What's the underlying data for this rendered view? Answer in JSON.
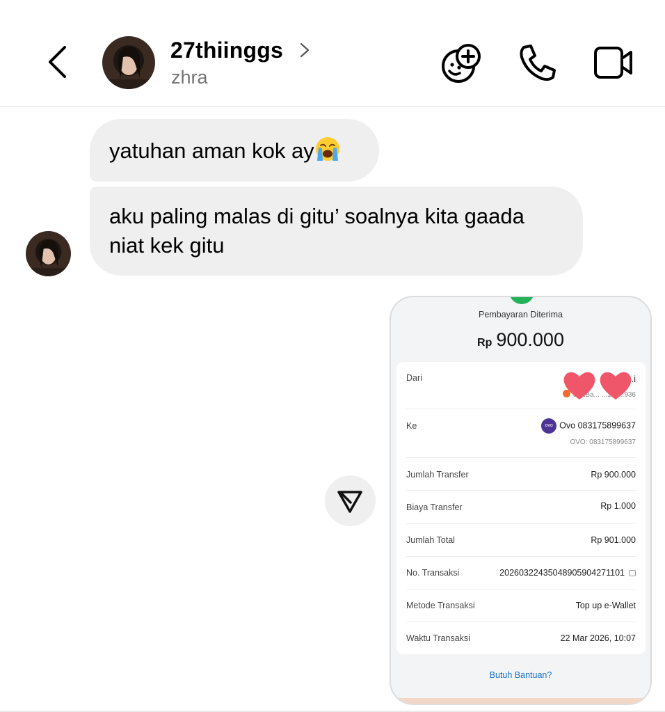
{
  "header": {
    "username": "27thiinggs",
    "subname": "zhra",
    "icons": [
      "back-chevron-icon",
      "add-friend-icon",
      "phone-icon",
      "video-camera-icon"
    ]
  },
  "messages": [
    {
      "text": "yatuhan aman kok ay",
      "emoji": "loudly-crying-face"
    },
    {
      "text": "aku paling malas di gitu’ soalnya kita gaada niat kek gitu"
    }
  ],
  "receipt": {
    "title": "Pembayaran Diterima",
    "currency": "Rp",
    "amount": "900.000",
    "rows": [
      {
        "label": "Dari",
        "value": "...i",
        "sub": "SeaBa... ...112...936"
      },
      {
        "label": "Ke",
        "value": "Ovo 083175899637",
        "sub": "OVO: 083175899637",
        "logo_text": "ovo"
      },
      {
        "label": "Jumlah Transfer",
        "value": "Rp 900.000"
      },
      {
        "label": "Biaya Transfer",
        "value": "Rp 1.000"
      },
      {
        "label": "Jumlah Total",
        "value": "Rp 901.000"
      },
      {
        "label": "No. Transaksi",
        "value": "20260322435048905904271101"
      },
      {
        "label": "Metode Transaksi",
        "value": "Top up e-Wallet"
      },
      {
        "label": "Waktu Transaksi",
        "value": "22 Mar 2026, 10:07"
      }
    ],
    "help": "Butuh Bantuan?"
  },
  "colors": {
    "bubble": "#efefef",
    "link": "#1a73c9",
    "heart": "#f0566a",
    "ovo": "#4c3494",
    "success": "#22b35a"
  }
}
